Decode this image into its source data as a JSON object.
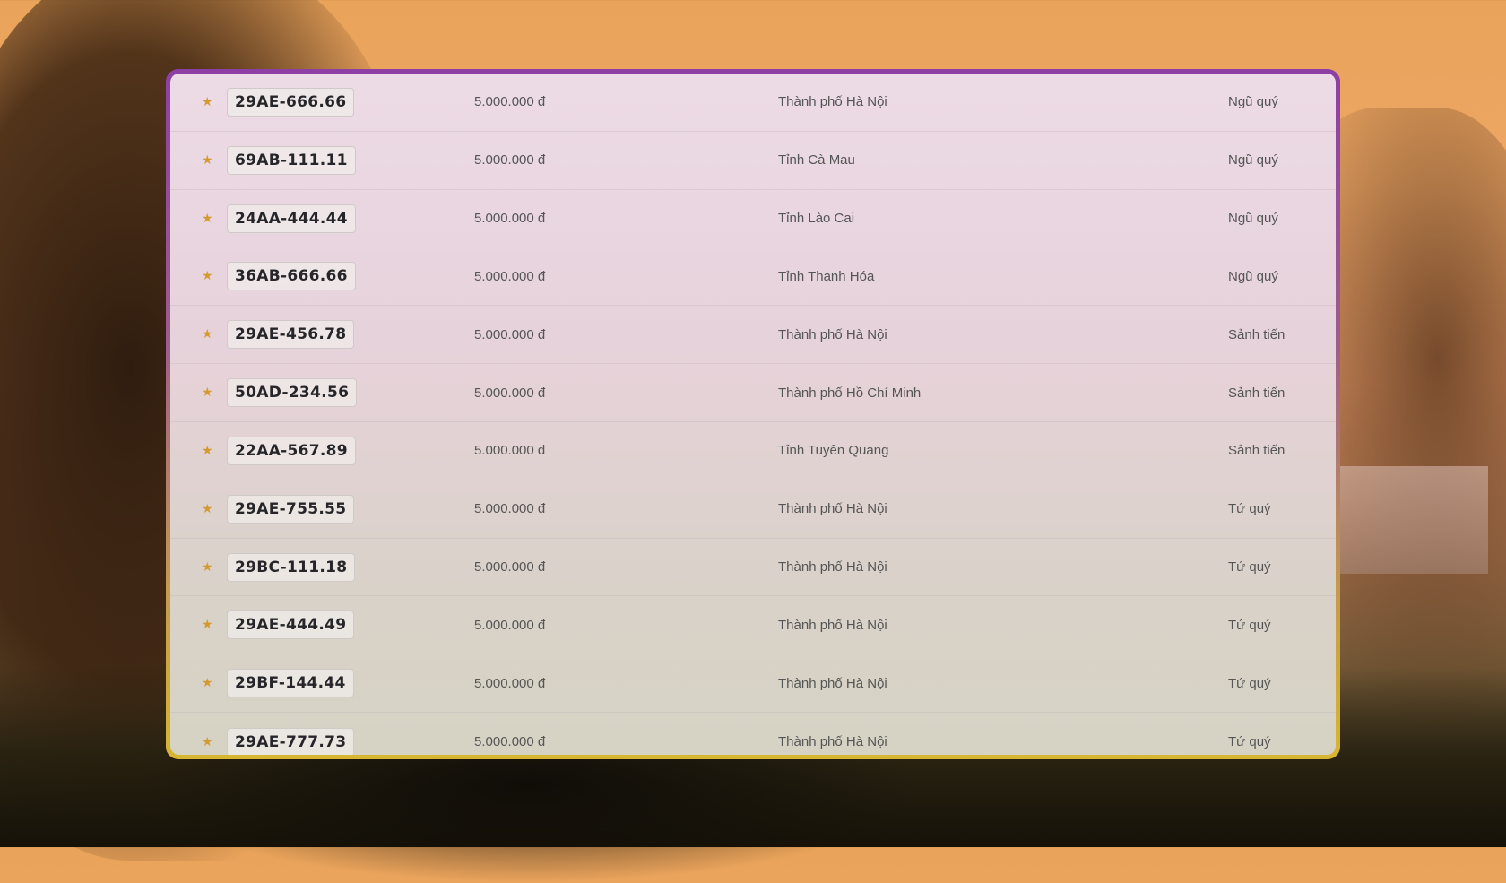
{
  "listing": {
    "rows": [
      {
        "plate": "29AE-666.66",
        "price": "5.000.000 đ",
        "province": "Thành phố Hà Nội",
        "category": "Ngũ quý"
      },
      {
        "plate": "69AB-111.11",
        "price": "5.000.000 đ",
        "province": "Tỉnh Cà Mau",
        "category": "Ngũ quý"
      },
      {
        "plate": "24AA-444.44",
        "price": "5.000.000 đ",
        "province": "Tỉnh Lào Cai",
        "category": "Ngũ quý"
      },
      {
        "plate": "36AB-666.66",
        "price": "5.000.000 đ",
        "province": "Tỉnh Thanh Hóa",
        "category": "Ngũ quý"
      },
      {
        "plate": "29AE-456.78",
        "price": "5.000.000 đ",
        "province": "Thành phố Hà Nội",
        "category": "Sảnh tiến"
      },
      {
        "plate": "50AD-234.56",
        "price": "5.000.000 đ",
        "province": "Thành phố Hồ Chí Minh",
        "category": "Sảnh tiến"
      },
      {
        "plate": "22AA-567.89",
        "price": "5.000.000 đ",
        "province": "Tỉnh Tuyên Quang",
        "category": "Sảnh tiến"
      },
      {
        "plate": "29AE-755.55",
        "price": "5.000.000 đ",
        "province": "Thành phố Hà Nội",
        "category": "Tứ quý"
      },
      {
        "plate": "29BC-111.18",
        "price": "5.000.000 đ",
        "province": "Thành phố Hà Nội",
        "category": "Tứ quý"
      },
      {
        "plate": "29AE-444.49",
        "price": "5.000.000 đ",
        "province": "Thành phố Hà Nội",
        "category": "Tứ quý"
      },
      {
        "plate": "29BF-144.44",
        "price": "5.000.000 đ",
        "province": "Thành phố Hà Nội",
        "category": "Tứ quý"
      },
      {
        "plate": "29AE-777.73",
        "price": "5.000.000 đ",
        "province": "Thành phố Hà Nội",
        "category": "Tứ quý"
      }
    ]
  },
  "icons": {
    "row_marker": "star-icon"
  },
  "colors": {
    "star": "#d49a2d",
    "panel_border_top": "#8e3fa6",
    "panel_border_bottom": "#d6b631",
    "plate_text": "#26262a"
  }
}
